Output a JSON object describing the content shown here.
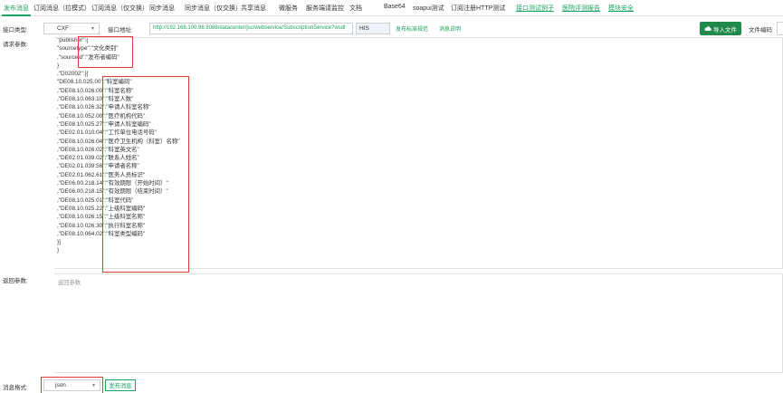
{
  "tabs": [
    {
      "label": "发布消息",
      "active": true
    },
    {
      "label": "订阅消息（拉模式）"
    },
    {
      "label": "订阅消息（仅交换）"
    },
    {
      "label": "同步消息"
    },
    {
      "label": "同步消息（仅交换）"
    },
    {
      "label": "共享消息"
    },
    {
      "label": "微服务"
    },
    {
      "label": "服务端请监控"
    },
    {
      "label": "文档"
    },
    {
      "label": "Base64"
    },
    {
      "label": "soapui测试"
    },
    {
      "label": "订阅注册HTTP测试"
    },
    {
      "label": "接口测试例子",
      "link": true
    },
    {
      "label": "医院评测报告",
      "link": true
    },
    {
      "label": "模块安全",
      "link": true
    }
  ],
  "form": {
    "interface_type_label": "接口类型:",
    "interface_type_value": "CXF",
    "interface_addr_label": "接口地址:",
    "interface_addr_value": "http://192.168.100.96:8088/datacenter/jsc/webservice/SubscriptionService?wsdl",
    "method_value": "HIS",
    "link_publish_spec": "发布标准规范",
    "link_message_desc": "消息说明",
    "import_button": "导入文件",
    "encoding_label": "文件编码",
    "request_label": "请求参数:",
    "return_label": "返回参数:",
    "return_placeholder": "返回参数",
    "message_format_label": "消息格式:",
    "message_format_value": "json",
    "publish_button": "发布消息"
  },
  "request_lines": [
    "\"publisher\":{",
    "\"sourcetype\":\"文化类别\"",
    ",\"sourceid\":\"发布者编码\"",
    "}",
    ",\"D02002\":[{",
    "\"DE08.10.025.00\":\"科室编码\"",
    ",\"DE08.10.026.00\":\"科室名称\"",
    ",\"DE08.10.063.10\":\"科室人数\"",
    ",\"DE08.10.026.32\":\"申请人科室名称\"",
    ",\"DE08.10.052.00\":\"医疗机构代码\"",
    ",\"DE08.10.025.27\":\"申请人科室编码\"",
    ",\"DE02.01.010.04\":\"工作单位电话号码\"",
    ",\"DE08.10.026.04\":\"医疗卫生机构（科室）名称\"",
    ",\"DE08.10.026.02\":\"科室英文名\"",
    ",\"DE02.01.039.02\":\"联系人姓名\"",
    ",\"DE02.01.039.56\":\"申请者名称\"",
    ",\"DE02.01.062.61\":\"医务人员标识\"",
    ",\"DE06.00.218.14\":\"有效期限（开始时间）\"",
    ",\"DE06.00.218.15\":\"有效期限（结束时间）\"",
    ",\"DE08.10.025.01\":\"科室代码\"",
    ",\"DE08.10.025.22\":\"上级科室编码\"",
    ",\"DE08.10.026.15\":\"上级科室名称\"",
    ",\"DE08.10.026.30\":\"执行科室名称\"",
    ",\"DE08.10.064.02\":\"科室类型编码\"",
    "}]",
    "}"
  ],
  "colors": {
    "accent": "#1aa260",
    "highlight": "#e53935",
    "button_bg": "#1f8a4c"
  }
}
